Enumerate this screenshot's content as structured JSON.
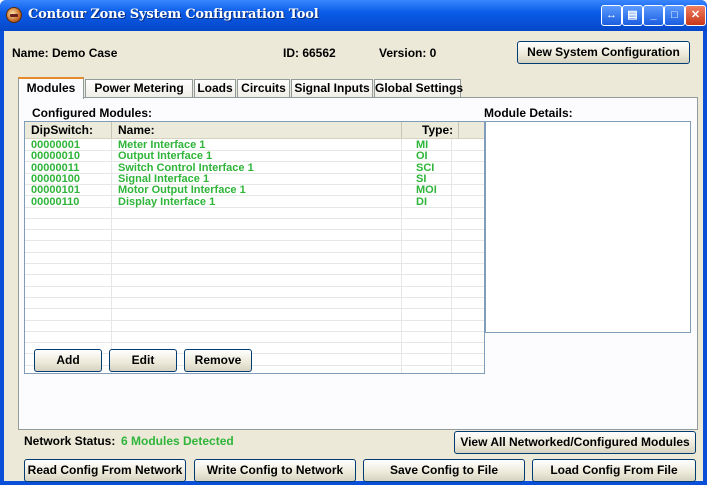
{
  "window": {
    "title": "Contour Zone System Configuration Tool"
  },
  "header": {
    "name_text": "Name: Demo Case",
    "id_text": "ID: 66562",
    "version_text": "Version: 0",
    "new_config_label": "New System Configuration"
  },
  "tabs": [
    {
      "label": "Modules",
      "active": true
    },
    {
      "label": "Power Metering"
    },
    {
      "label": "Loads"
    },
    {
      "label": "Circuits"
    },
    {
      "label": "Signal Inputs"
    },
    {
      "label": "Global Settings"
    }
  ],
  "modules": {
    "title": "Configured Modules:",
    "columns": [
      "DipSwitch:",
      "Name:",
      "Type:"
    ],
    "rows": [
      {
        "dip": "00000001",
        "name": "Meter Interface 1",
        "type": "MI"
      },
      {
        "dip": "00000010",
        "name": "Output Interface 1",
        "type": "OI"
      },
      {
        "dip": "00000011",
        "name": "Switch Control Interface 1",
        "type": "SCI"
      },
      {
        "dip": "00000100",
        "name": "Signal Interface 1",
        "type": "SI"
      },
      {
        "dip": "00000101",
        "name": "Motor Output Interface 1",
        "type": "MOI"
      },
      {
        "dip": "00000110",
        "name": "Display Interface 1",
        "type": "DI"
      }
    ],
    "text_color": "#2fb53a",
    "add_label": "Add",
    "edit_label": "Edit",
    "remove_label": "Remove"
  },
  "details": {
    "title": "Module Details:"
  },
  "status": {
    "label": "Network Status:",
    "value": "6 Modules Detected",
    "value_color": "#2fb53a",
    "view_all_label": "View All Networked/Configured Modules"
  },
  "footer": {
    "read_label": "Read Config From Network",
    "write_label": "Write Config to Network",
    "save_label": "Save Config to File",
    "load_label": "Load Config From File"
  },
  "icons": {
    "app": "contour-app-icon",
    "titlebar_buttons": [
      "help-icon",
      "restore-icon",
      "minimize-icon",
      "maximize-icon",
      "close-icon"
    ]
  },
  "accent_color": "#0a4fd8"
}
